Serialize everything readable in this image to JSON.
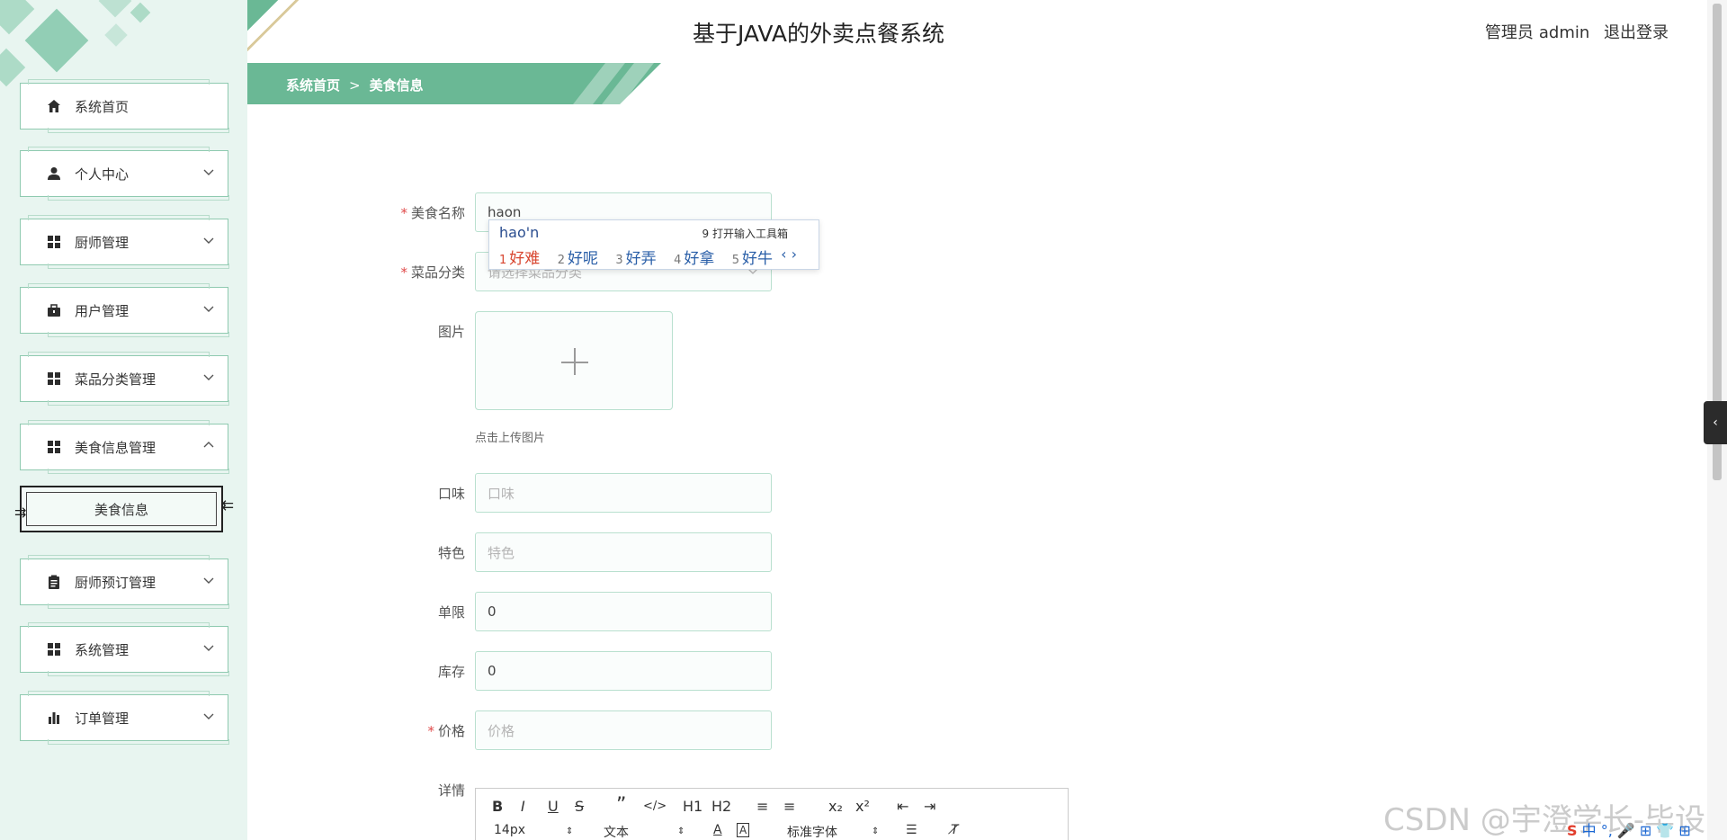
{
  "header": {
    "title": "基于JAVA的外卖点餐系统",
    "user_role": "管理员",
    "username": "admin",
    "logout": "退出登录"
  },
  "breadcrumb": {
    "home": "系统首页",
    "sep": ">",
    "current": "美食信息"
  },
  "sidebar": {
    "items": [
      {
        "label": "系统首页",
        "icon": "home-icon"
      },
      {
        "label": "个人中心",
        "icon": "user-icon"
      },
      {
        "label": "厨师管理",
        "icon": "grid-icon"
      },
      {
        "label": "用户管理",
        "icon": "briefcase-icon"
      },
      {
        "label": "菜品分类管理",
        "icon": "grid-icon"
      },
      {
        "label": "美食信息管理",
        "icon": "grid-icon"
      },
      {
        "label": "厨师预订管理",
        "icon": "clipboard-icon"
      },
      {
        "label": "系统管理",
        "icon": "grid-icon"
      },
      {
        "label": "订单管理",
        "icon": "bar-chart-icon"
      }
    ],
    "active_sub": "美食信息"
  },
  "form": {
    "name_label": "美食名称",
    "name_value": "haon",
    "category_label": "菜品分类",
    "category_placeholder": "请选择菜品分类",
    "image_label": "图片",
    "upload_tip": "点击上传图片",
    "taste_label": "口味",
    "taste_placeholder": "口味",
    "feature_label": "特色",
    "feature_placeholder": "特色",
    "limit_label": "单限",
    "limit_value": "0",
    "stock_label": "库存",
    "stock_value": "0",
    "price_label": "价格",
    "price_placeholder": "价格",
    "detail_label": "详情"
  },
  "ime": {
    "composition": "hao'n",
    "tool": "9 打开输入工具箱",
    "candidates": [
      {
        "num": "1",
        "text": "好难"
      },
      {
        "num": "2",
        "text": "好呢"
      },
      {
        "num": "3",
        "text": "好弄"
      },
      {
        "num": "4",
        "text": "好拿"
      },
      {
        "num": "5",
        "text": "好牛"
      }
    ],
    "nav": "‹ ›"
  },
  "editor": {
    "toolbar_row1": [
      "B",
      "I",
      "U",
      "S",
      "”",
      "</>",
      "H1",
      "H2",
      "≡",
      "≡",
      "x₂",
      "x²",
      "⇤",
      "⇥"
    ],
    "font_size": "14px",
    "block_type": "文本",
    "font_family": "标准字体"
  },
  "watermark": "CSDN @宇澄学长-毕设",
  "tray": "中 °, 🎤 ⊞ 👕 ⊞"
}
